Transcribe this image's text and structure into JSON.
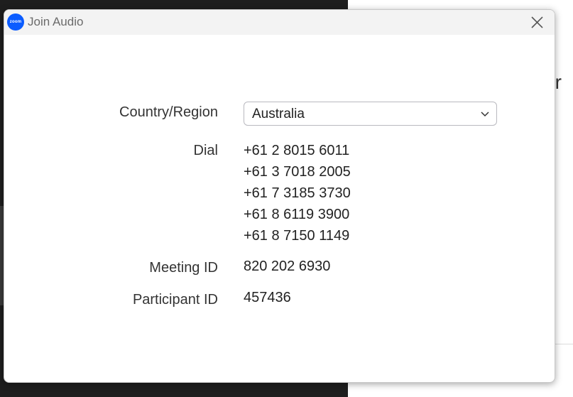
{
  "window": {
    "title": "Join Audio",
    "logo_text": "zoom"
  },
  "background": {
    "partial_text": "r"
  },
  "form": {
    "country_label": "Country/Region",
    "country_value": "Australia",
    "dial_label": "Dial",
    "dial_numbers": [
      "+61 2 8015 6011",
      "+61 3 7018 2005",
      "+61 7 3185 3730",
      "+61 8 6119 3900",
      "+61 8 7150 1149"
    ],
    "meeting_id_label": "Meeting ID",
    "meeting_id_value": "820 202 6930",
    "participant_id_label": "Participant ID",
    "participant_id_value": "457436"
  },
  "icons": {
    "app": "zoom-logo-icon",
    "close": "close-icon",
    "dropdown": "chevron-down-icon"
  },
  "colors": {
    "brand": "#0b5cff",
    "titlebar": "#f3f3f3",
    "text": "#222222"
  }
}
